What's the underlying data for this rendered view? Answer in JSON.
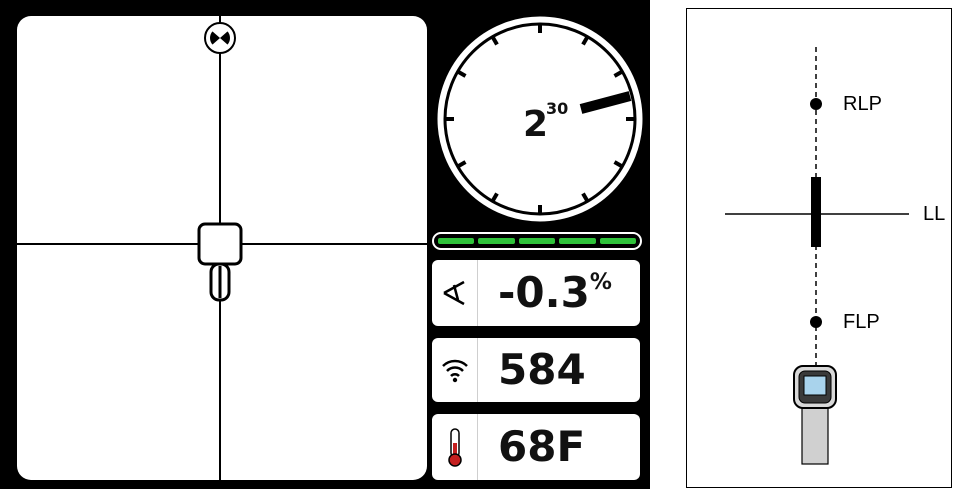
{
  "locate_screen": {
    "roll": {
      "hour": "2",
      "minute": "30"
    },
    "signal_bars": {
      "filled": 5,
      "total": 5,
      "color": "#2fc23a"
    },
    "pitch": {
      "value": "-0.3",
      "unit": "%"
    },
    "signal_strength": {
      "value": "584"
    },
    "temperature": {
      "value": "68F"
    },
    "icons": {
      "target": "target-ball-icon",
      "receiver": "receiver-box-icon",
      "pitch": "pitch-angle-icon",
      "signal": "wifi-signal-icon",
      "temperature": "thermometer-icon"
    }
  },
  "diagram": {
    "labels": {
      "rlp": "RLP",
      "ll": "LL",
      "flp": "FLP"
    },
    "icons": {
      "receiver": "handheld-receiver-icon"
    }
  }
}
